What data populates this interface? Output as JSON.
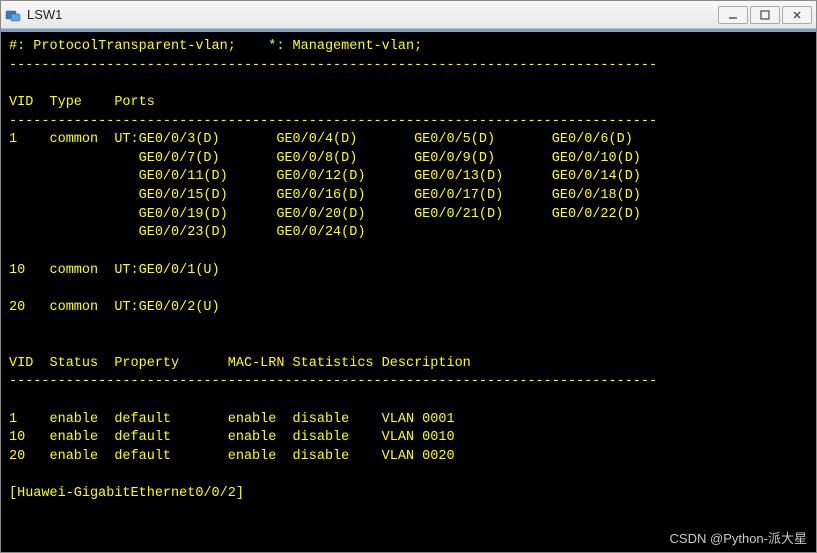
{
  "window": {
    "title": "LSW1"
  },
  "terminal": {
    "legend": "#: ProtocolTransparent-vlan;    *: Management-vlan;",
    "hr": "--------------------------------------------------------------------------------",
    "header1": "VID  Type    Ports",
    "vlans": [
      {
        "vid": "1",
        "type": "common",
        "prefix": "UT:",
        "ports_rows": [
          [
            "GE0/0/3(D)",
            "GE0/0/4(D)",
            "GE0/0/5(D)",
            "GE0/0/6(D)"
          ],
          [
            "GE0/0/7(D)",
            "GE0/0/8(D)",
            "GE0/0/9(D)",
            "GE0/0/10(D)"
          ],
          [
            "GE0/0/11(D)",
            "GE0/0/12(D)",
            "GE0/0/13(D)",
            "GE0/0/14(D)"
          ],
          [
            "GE0/0/15(D)",
            "GE0/0/16(D)",
            "GE0/0/17(D)",
            "GE0/0/18(D)"
          ],
          [
            "GE0/0/19(D)",
            "GE0/0/20(D)",
            "GE0/0/21(D)",
            "GE0/0/22(D)"
          ],
          [
            "GE0/0/23(D)",
            "GE0/0/24(D)",
            "",
            ""
          ]
        ]
      },
      {
        "vid": "10",
        "type": "common",
        "prefix": "UT:",
        "ports_rows": [
          [
            "GE0/0/1(U)",
            "",
            "",
            ""
          ]
        ]
      },
      {
        "vid": "20",
        "type": "common",
        "prefix": "UT:",
        "ports_rows": [
          [
            "GE0/0/2(U)",
            "",
            "",
            ""
          ]
        ]
      }
    ],
    "header2": "VID  Status  Property      MAC-LRN Statistics Description",
    "status_rows": [
      {
        "vid": "1",
        "status": "enable",
        "property": "default",
        "maclrn": "enable",
        "stats": "disable",
        "desc": "VLAN 0001"
      },
      {
        "vid": "10",
        "status": "enable",
        "property": "default",
        "maclrn": "enable",
        "stats": "disable",
        "desc": "VLAN 0010"
      },
      {
        "vid": "20",
        "status": "enable",
        "property": "default",
        "maclrn": "enable",
        "stats": "disable",
        "desc": "VLAN 0020"
      }
    ],
    "prompt": "[Huawei-GigabitEthernet0/0/2]"
  },
  "watermark": "CSDN @Python-派大星"
}
